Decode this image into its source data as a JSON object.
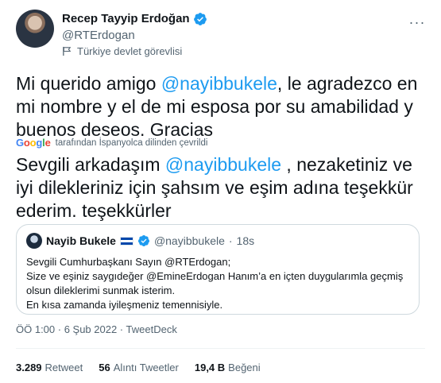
{
  "author": {
    "name": "Recep Tayyip Erdoğan",
    "handle": "@RTErdogan",
    "label": "Türkiye devlet görevlisi",
    "verified": true
  },
  "tweet": {
    "original_prefix": "Mi querido amigo ",
    "original_mention": "@nayibbukele",
    "original_suffix": ", le agradezco en mi nombre y el de mi esposa por su amabilidad y buenos deseos. Gracias",
    "translate_note": "tarafından İspanyolca dilinden çevrildi",
    "translated_prefix": "Sevgili arkadaşım ",
    "translated_mention": "@nayibbukele",
    "translated_suffix": " , nezaketiniz ve iyi dilekleriniz için şahsım ve eşim adına teşekkür ederim. teşekkürler"
  },
  "quote": {
    "name": "Nayib Bukele",
    "handle": "@nayibbukele",
    "time": "18s",
    "line1": "Sevgili Cumhurbaşkanı Sayın @RTErdogan;",
    "line2": "Size ve eşiniz saygıdeğer @EmineErdogan Hanım’a en içten duygularımla geçmiş olsun dileklerimi sunmak isterim.",
    "line3": "En kısa zamanda iyileşmeniz temennisiyle."
  },
  "meta": {
    "text": "ÖÖ 1:00 · 6 Şub 2022 · TweetDeck"
  },
  "stats": {
    "retweets_count": "3.289",
    "retweets_label": "Retweet",
    "quotes_count": "56",
    "quotes_label": "Alıntı Tweetler",
    "likes_count": "19,4 B",
    "likes_label": "Beğeni"
  },
  "colors": {
    "accent": "#1d9bf0",
    "secondary_text": "#536471"
  }
}
